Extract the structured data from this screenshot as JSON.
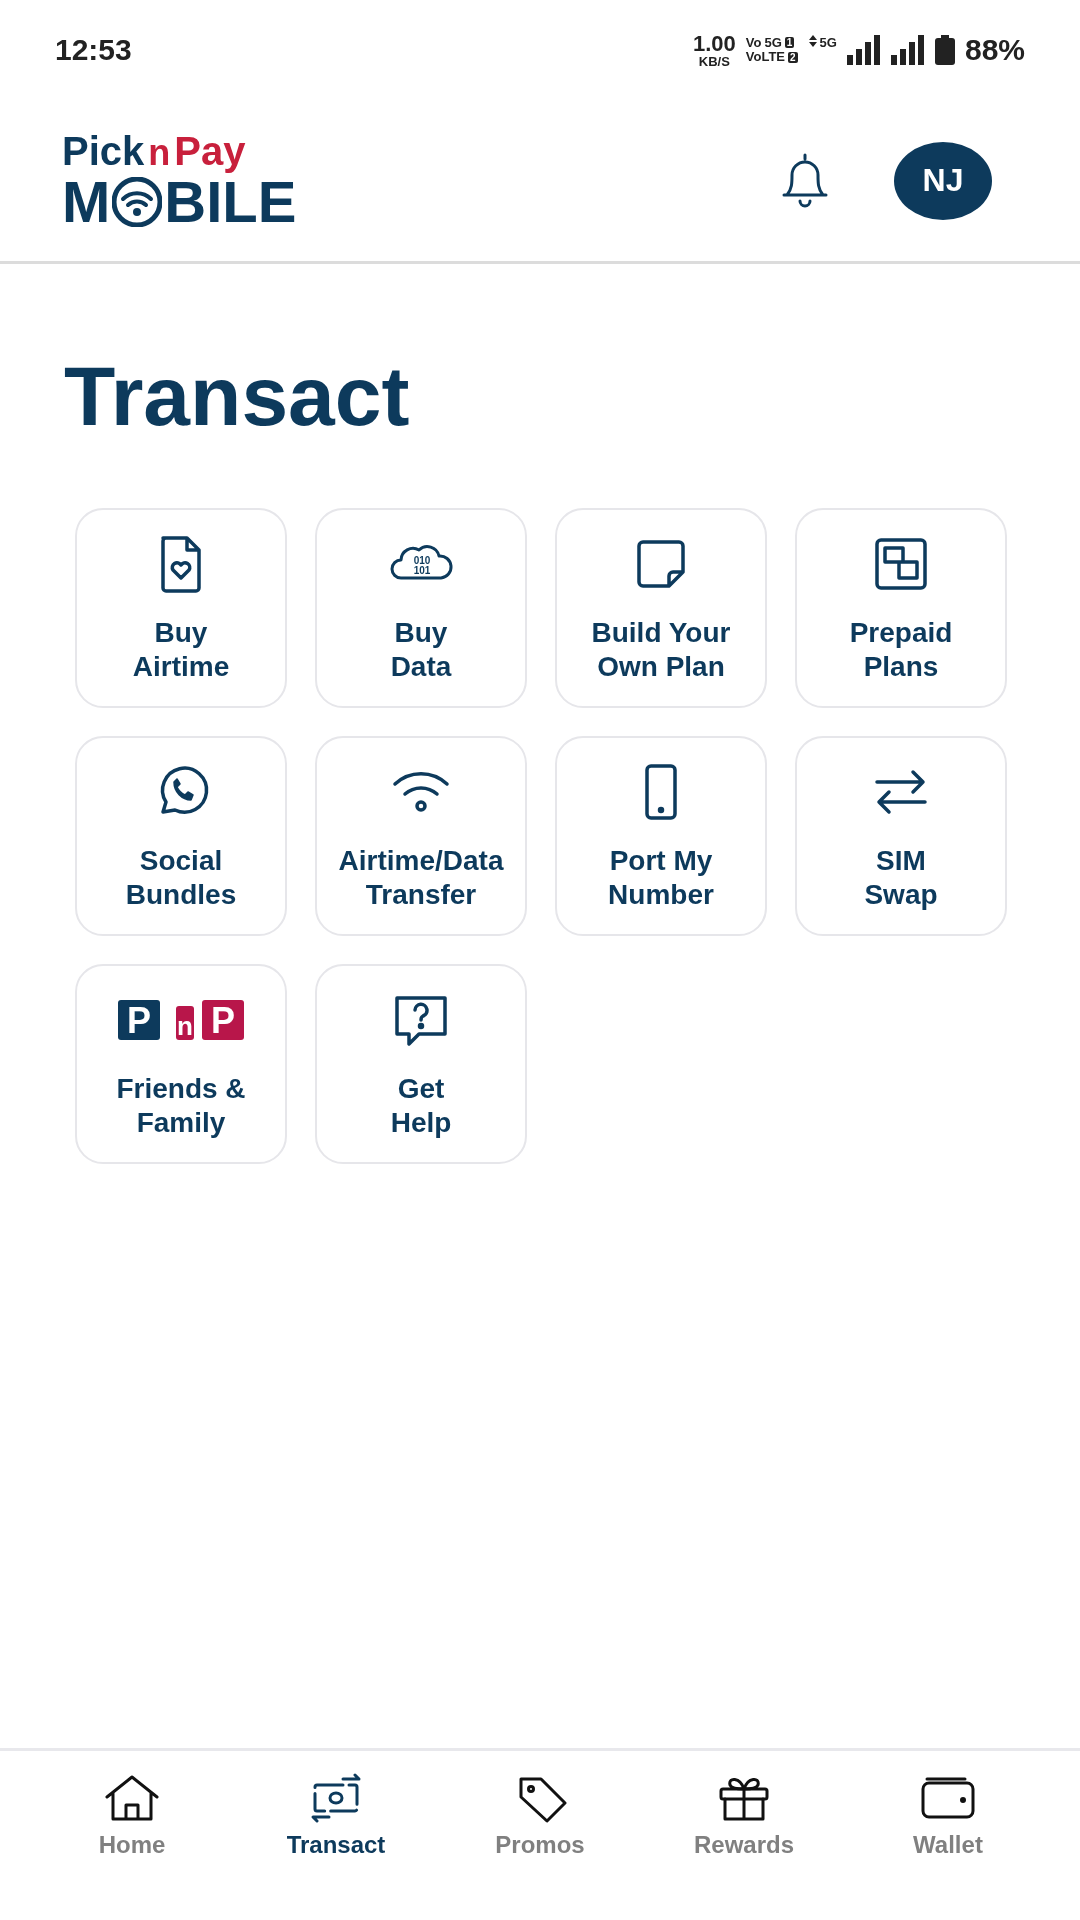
{
  "status_bar": {
    "time": "12:53",
    "speed": "1.00",
    "speed_unit": "KB/S",
    "volte_top": "Vo",
    "sim1_network": "5G",
    "sim1": "1",
    "volte_bottom": "VoLTE",
    "sim2": "2",
    "network": "5G",
    "battery": "88%"
  },
  "header": {
    "logo": {
      "pick": "Pick",
      "n": "n",
      "pay": "Pay",
      "mobile_start": "M",
      "mobile_end": "BILE"
    },
    "avatar": "NJ"
  },
  "title": "Transact",
  "tiles": [
    {
      "kind": "icon",
      "lines": [
        "Buy",
        "Airtime"
      ]
    },
    {
      "kind": "icon",
      "lines": [
        "Buy",
        "Data"
      ],
      "icon_text": [
        "010",
        "101"
      ]
    },
    {
      "kind": "icon",
      "lines": [
        "Build Your",
        "Own Plan"
      ]
    },
    {
      "kind": "icon",
      "lines": [
        "Prepaid",
        "Plans"
      ]
    },
    {
      "kind": "icon",
      "lines": [
        "Social",
        "Bundles"
      ]
    },
    {
      "kind": "icon",
      "lines": [
        "Airtime/Data",
        "Transfer"
      ]
    },
    {
      "kind": "icon",
      "lines": [
        "Port My",
        "Number"
      ]
    },
    {
      "kind": "icon",
      "lines": [
        "SIM",
        "Swap"
      ]
    },
    {
      "kind": "logo",
      "lines": [
        "Friends &",
        "Family"
      ],
      "logo_letters": [
        "P",
        "n",
        "P"
      ]
    },
    {
      "kind": "icon",
      "lines": [
        "Get",
        "Help"
      ]
    }
  ],
  "nav": [
    {
      "label": "Home",
      "selected": false
    },
    {
      "label": "Transact",
      "selected": true
    },
    {
      "label": "Promos",
      "selected": false
    },
    {
      "label": "Rewards",
      "selected": false
    },
    {
      "label": "Wallet",
      "selected": false
    }
  ]
}
